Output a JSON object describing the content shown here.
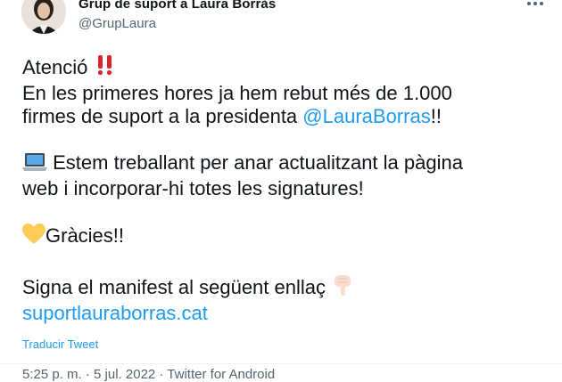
{
  "author": {
    "name": "Grup de suport a Laura Borràs",
    "handle": "@GrupLaura"
  },
  "tweet": {
    "line1_text": "Atenció",
    "line2": "En les primeres hores ja hem rebut més de 1.000",
    "line3_prefix": "firmes de suport a la presidenta",
    "mention": "@LauraBorras",
    "line3_suffix": "!!",
    "line4": "Estem treballant per anar actualitzant la pàgina",
    "line5": "web i incorporar-hi totes les signatures!",
    "line6": "Gràcies!!",
    "line7": "Signa el manifest al següent enllaç",
    "link": "suportlauraborras.cat"
  },
  "actions": {
    "translate": "Traducir Tweet"
  },
  "meta": {
    "text": "5:25 p. m. · 5 jul. 2022 · Twitter for Android"
  },
  "colors": {
    "accent": "#1d9bf0",
    "text": "#0f1419",
    "secondary": "#536471"
  },
  "icons": {
    "double_exclamation": "double-exclamation-icon",
    "laptop": "laptop-icon",
    "heart": "yellow-heart-icon",
    "pointing": "pointing-down-icon",
    "more": "more-icon"
  }
}
